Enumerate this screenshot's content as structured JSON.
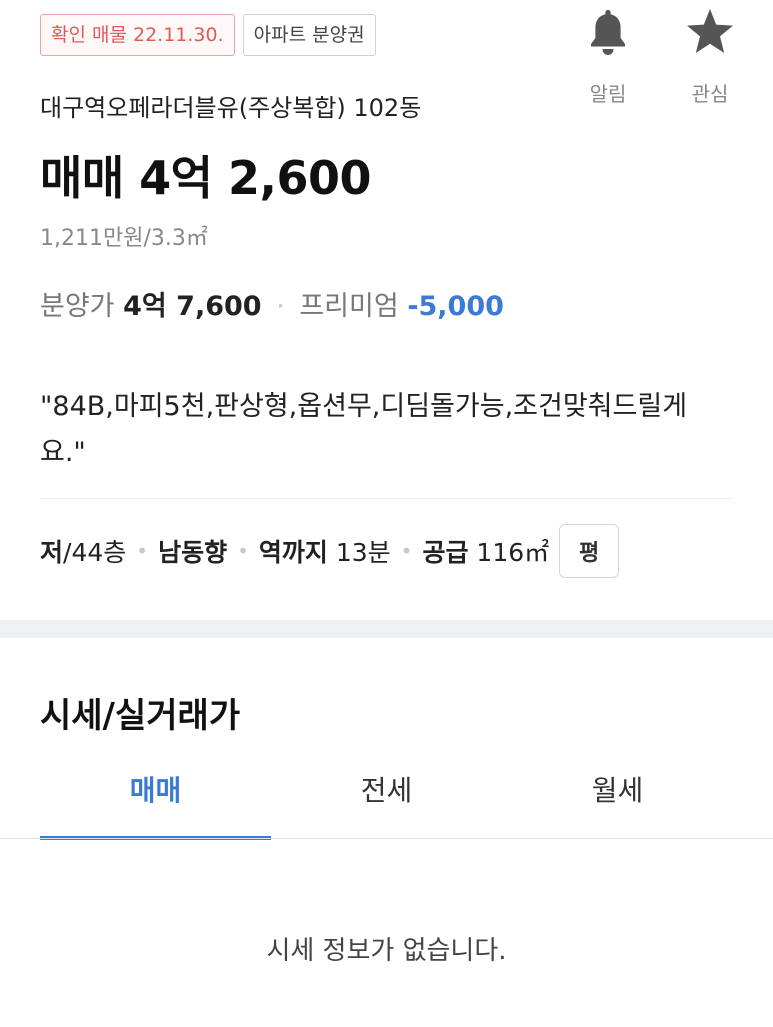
{
  "badges": {
    "confirmed": "확인 매물 22.11.30.",
    "type": "아파트 분양권"
  },
  "actions": {
    "alert_label": "알림",
    "alert_icon": "bell-icon",
    "favorite_label": "관심",
    "favorite_icon": "star-icon"
  },
  "listing": {
    "title": "대구역오페라더블유(주상복합) 102동",
    "price": "매매 4억 2,600",
    "unit_price": "1,211만원/3.3㎡",
    "presale_label": "분양가",
    "presale_price": "4억 7,600",
    "premium_label": "프리미엄",
    "premium_value": "-5,000",
    "description": "\"84B,마피5천,판상형,옵션무,디딤돌가능,조건맞춰드릴게요.\""
  },
  "specs": {
    "floor_bold": "저",
    "floor_rest": "/44층",
    "direction": "남동향",
    "station_bold": "역까지",
    "station_rest": " 13분",
    "supply_bold": "공급",
    "supply_rest": " 116㎡",
    "unit_toggle": "평"
  },
  "market": {
    "section_title": "시세/실거래가",
    "tabs": [
      "매매",
      "전세",
      "월세"
    ],
    "active_tab": "매매",
    "empty_message": "시세 정보가 없습니다."
  },
  "colors": {
    "accent": "#3b7ad6",
    "badge_red": "#e05a5a",
    "icon_gray": "#555555"
  }
}
